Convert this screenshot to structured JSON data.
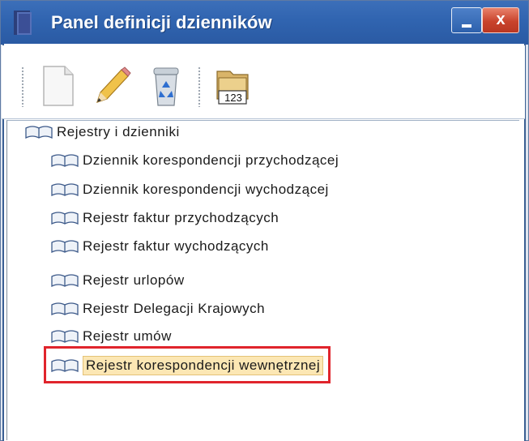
{
  "window": {
    "title": "Panel definicji dzienników",
    "close_glyph": "x",
    "minimize_icon": "minimize-icon"
  },
  "toolbar": {
    "buttons": [
      {
        "name": "new-document-icon",
        "tooltip": ""
      },
      {
        "name": "pencil-icon",
        "tooltip": ""
      },
      {
        "name": "recycle-bin-icon",
        "tooltip": ""
      },
      {
        "name": "numbered-folder-icon",
        "label": "123"
      }
    ]
  },
  "tree": {
    "root": {
      "label": "Rejestry i dzienniki",
      "icon": "book-icon"
    },
    "items": [
      {
        "label": "Dziennik korespondencji przychodzącej",
        "icon": "book-icon"
      },
      {
        "label": "Dziennik korespondencji wychodzącej",
        "icon": "book-icon"
      },
      {
        "label": "Rejestr faktur przychodzących",
        "icon": "book-icon"
      },
      {
        "label": "Rejestr faktur wychodzących",
        "icon": "book-icon"
      },
      {
        "label": "Rejestr urlopów",
        "icon": "book-icon"
      },
      {
        "label": "Rejestr Delegacji Krajowych",
        "icon": "book-icon"
      },
      {
        "label": "Rejestr umów",
        "icon": "book-icon"
      },
      {
        "label": "Rejestr korespondencji wewnętrznej",
        "icon": "book-icon",
        "selected": true
      }
    ]
  },
  "colors": {
    "titlebar": "#3064b0",
    "selection": "#fce7b4",
    "highlight_box": "#e0242c"
  }
}
